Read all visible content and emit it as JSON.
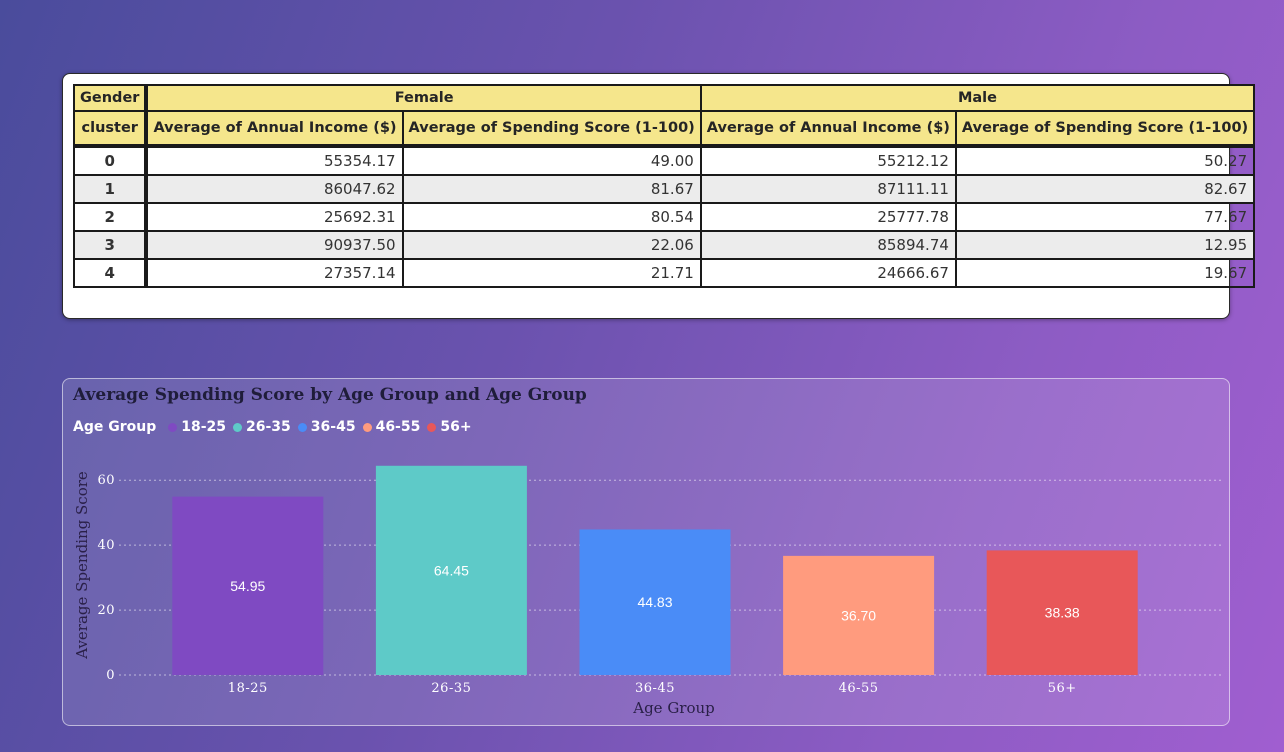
{
  "table": {
    "header_row1": {
      "corner": "Gender",
      "groups": [
        "Female",
        "Male"
      ]
    },
    "header_row2": {
      "corner": "cluster",
      "columns": [
        "Average of Annual Income ($)",
        "Average of Spending Score (1-100)",
        "Average of Annual Income ($)",
        "Average of Spending Score (1-100)"
      ]
    },
    "rows": [
      {
        "cluster": "0",
        "values": [
          "55354.17",
          "49.00",
          "55212.12",
          "50.27"
        ]
      },
      {
        "cluster": "1",
        "values": [
          "86047.62",
          "81.67",
          "87111.11",
          "82.67"
        ]
      },
      {
        "cluster": "2",
        "values": [
          "25692.31",
          "80.54",
          "25777.78",
          "77.67"
        ]
      },
      {
        "cluster": "3",
        "values": [
          "90937.50",
          "22.06",
          "85894.74",
          "12.95"
        ]
      },
      {
        "cluster": "4",
        "values": [
          "27357.14",
          "21.71",
          "24666.67",
          "19.67"
        ]
      }
    ]
  },
  "chart_data": {
    "type": "bar",
    "title": "Average Spending Score by Age Group and Age Group",
    "legend_title": "Age Group",
    "legend_position": "top-left",
    "categories": [
      "18-25",
      "26-35",
      "36-45",
      "46-55",
      "56+"
    ],
    "values": [
      54.95,
      64.45,
      44.83,
      36.7,
      38.38
    ],
    "value_labels": [
      "54.95",
      "64.45",
      "44.83",
      "36.70",
      "38.38"
    ],
    "colors": [
      "#7f4ac2",
      "#5ecac8",
      "#4a8cf7",
      "#ff9b7e",
      "#e85759"
    ],
    "xlabel": "Age Group",
    "ylabel": "Average Spending Score",
    "yticks": [
      0,
      20,
      40,
      60
    ],
    "ylim": [
      0,
      65
    ],
    "grid": true
  }
}
